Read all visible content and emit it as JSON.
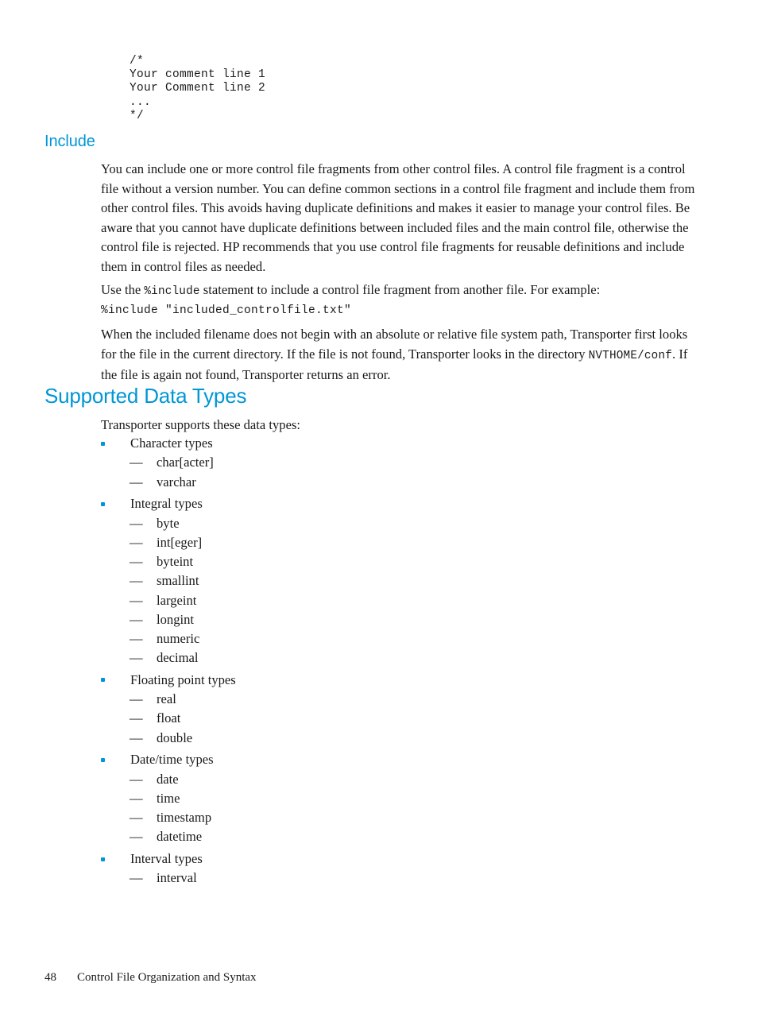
{
  "document": {
    "page_number": "48",
    "footer_title": "Control File Organization and Syntax",
    "accent_color": "#0096d6"
  },
  "top_code_block": {
    "lines": [
      "/*",
      "Your comment line 1",
      "Your Comment line 2",
      "...",
      "*/"
    ]
  },
  "include_section": {
    "heading": "Include",
    "paragraph_1": "You can include one or more control file fragments from other control files. A control file fragment is a control file without a version number. You can define common sections in a control file fragment and include them from other control files. This avoids having duplicate definitions and makes it easier to manage your control files. Be aware that you cannot have duplicate definitions between included files and the main control file, otherwise the control file is rejected. HP recommends that you use control file fragments for reusable definitions and include them in control files as needed.",
    "paragraph_2_before": "Use the ",
    "paragraph_2_code": "%include",
    "paragraph_2_after": " statement to include a control file fragment from another file. For example:",
    "code_statement": "%include \"included_controlfile.txt\"",
    "paragraph_3_before": "When the included filename does not begin with an absolute or relative file system path, Transporter first looks for the file in the current directory. If the file is not found, Transporter looks in the directory ",
    "paragraph_3_code": "NVTHOME/conf",
    "paragraph_3_after": ". If the file is again not found, Transporter returns an error."
  },
  "data_types_section": {
    "heading": "Supported Data Types",
    "intro": "Transporter supports these data types:",
    "groups": [
      {
        "label": "Character types",
        "items": [
          "char[acter]",
          "varchar"
        ]
      },
      {
        "label": "Integral types",
        "items": [
          "byte",
          "int[eger]",
          "byteint",
          "smallint",
          "largeint",
          "longint",
          "numeric",
          "decimal"
        ]
      },
      {
        "label": "Floating point types",
        "items": [
          "real",
          "float",
          "double"
        ]
      },
      {
        "label": "Date/time types",
        "items": [
          "date",
          "time",
          "timestamp",
          "datetime"
        ]
      },
      {
        "label": "Interval types",
        "items": [
          "interval"
        ]
      }
    ]
  }
}
